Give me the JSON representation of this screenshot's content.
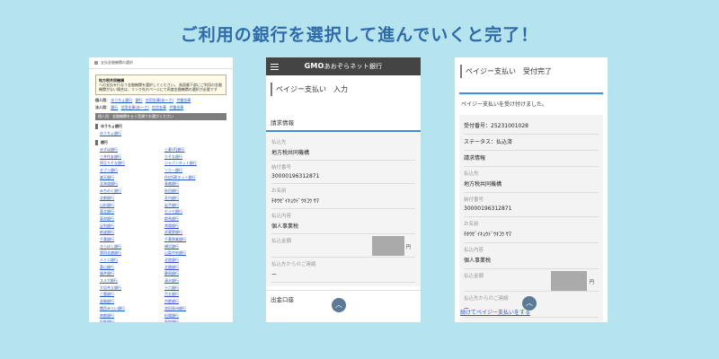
{
  "headline": "ご利用の銀行を選択して進んでいくと完了！",
  "panel1": {
    "title": "支払金融機関の選択",
    "notice_title": "地方税共同機構",
    "notice_text1": "への支払を行なう金融機関を選択してください。",
    "notice_text2": "画面最下部にご利用の金融機関がない場合は、リンク先のページにて再度金融機関の選択が必要です",
    "row1_label": "個人用：",
    "row1_links": [
      "ゆうちょ銀行",
      "銀行",
      "信用金庫(あ〜さ)",
      "労働金庫"
    ],
    "row1_extra": [
      "労働金庫"
    ],
    "row2_label": "法人用：",
    "row2_links": [
      "銀行",
      "信用金庫(あ〜さ)",
      "信用金庫",
      "労働金庫"
    ],
    "bar": "個人用：金融機関を五十音順でお選びください",
    "sec1": "ゆうちょ銀行",
    "sec1_item": "ゆうちょ銀行",
    "sec2": "銀行",
    "banks": [
      "みずほ銀行",
      "三菱UFJ銀行",
      "三井住友銀行",
      "りそな銀行",
      "埼玉りそな銀行",
      "ジャパンネット銀行",
      "セブン銀行",
      "ソニー銀行",
      "楽天銀行",
      "住信SBIネット銀行",
      "北海道銀行",
      "青森銀行",
      "みちのく銀行",
      "秋田銀行",
      "北都銀行",
      "荘内銀行",
      "山形銀行",
      "岩手銀行",
      "東北銀行",
      "七十七銀行",
      "東邦銀行",
      "群馬銀行",
      "足利銀行",
      "常陽銀行",
      "筑波銀行",
      "武蔵野銀行",
      "千葉銀行",
      "千葉興業銀行",
      "きらぼし銀行",
      "横浜銀行",
      "第四北越銀行",
      "山梨中央銀行",
      "八十二銀行",
      "北陸銀行",
      "富山銀行",
      "北國銀行",
      "福井銀行",
      "静岡銀行",
      "スルガ銀行",
      "清水銀行",
      "大垣共立銀行",
      "十六銀行",
      "三重銀行",
      "百五銀行",
      "滋賀銀行",
      "京都銀行",
      "関西みらい銀行",
      "池田泉州銀行",
      "南都銀行",
      "紀陽銀行",
      "但馬銀行",
      "鳥取銀行",
      "山陰合同銀行",
      "中国銀行",
      "広島銀行",
      "山口銀行",
      "阿波銀行",
      "百十四銀行",
      "伊予銀行",
      "四国銀行"
    ]
  },
  "panel2": {
    "brand_bold": "GMO",
    "brand_rest": "あおぞらネット銀行",
    "header": "ペイジー支払い　入力",
    "section": "請求情報",
    "fields": [
      {
        "label": "払込先",
        "value": "地方税共同機構"
      },
      {
        "label": "納付番号",
        "value": "30000196312871"
      },
      {
        "label": "お名前",
        "value": "ﾁﾎｳｾﾞｲｷｮｳﾄﾞｳｷｺｳ ｻﾏ"
      },
      {
        "label": "払込内容",
        "value": "個人事業税"
      },
      {
        "label": "払込金額",
        "value": ""
      },
      {
        "label": "払込先からのご連絡",
        "value": "ー"
      }
    ],
    "yen": "円",
    "bottom": "出金口座",
    "up": "︿"
  },
  "panel3": {
    "header": "ペイジー支払い　受付完了",
    "message": "ペイジー支払いを受け付けました。",
    "receipt": "受付番号：25231001028",
    "status": "ステータス：払込済",
    "section": "請求情報",
    "fields": [
      {
        "label": "払込先",
        "value": "地方税共同機構"
      },
      {
        "label": "納付番号",
        "value": "30000196312871"
      },
      {
        "label": "お名前",
        "value": "ﾁﾎｳｾﾞｲｷｮｳﾄﾞｳｷｺｳ ｻﾏ"
      },
      {
        "label": "払込内容",
        "value": "個人事業税"
      },
      {
        "label": "払込金額",
        "value": ""
      },
      {
        "label": "払込先からのご連絡",
        "value": "ー"
      }
    ],
    "yen": "円",
    "link": "続けてペイジー支払いをする",
    "up": "︿"
  }
}
